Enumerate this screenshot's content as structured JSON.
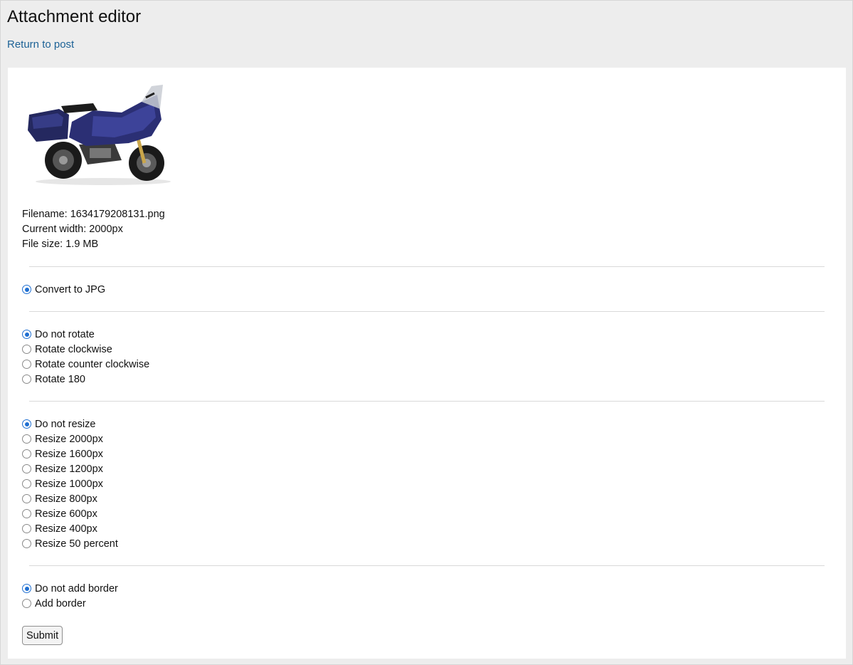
{
  "header": {
    "title": "Attachment editor",
    "return_link": "Return to post"
  },
  "file_info": {
    "filename": "Filename: 1634179208131.png",
    "width": "Current width: 2000px",
    "size": "File size: 1.9 MB"
  },
  "convert": {
    "options": [
      {
        "label": "Convert to JPG",
        "checked": true
      }
    ]
  },
  "rotate": {
    "options": [
      {
        "label": "Do not rotate",
        "checked": true
      },
      {
        "label": "Rotate clockwise",
        "checked": false
      },
      {
        "label": "Rotate counter clockwise",
        "checked": false
      },
      {
        "label": "Rotate 180",
        "checked": false
      }
    ]
  },
  "resize": {
    "options": [
      {
        "label": "Do not resize",
        "checked": true
      },
      {
        "label": "Resize 2000px",
        "checked": false
      },
      {
        "label": "Resize 1600px",
        "checked": false
      },
      {
        "label": "Resize 1200px",
        "checked": false
      },
      {
        "label": "Resize 1000px",
        "checked": false
      },
      {
        "label": "Resize 800px",
        "checked": false
      },
      {
        "label": "Resize 600px",
        "checked": false
      },
      {
        "label": "Resize 400px",
        "checked": false
      },
      {
        "label": "Resize 50 percent",
        "checked": false
      }
    ]
  },
  "border": {
    "options": [
      {
        "label": "Do not add border",
        "checked": true
      },
      {
        "label": "Add border",
        "checked": false
      }
    ]
  },
  "form": {
    "submit_label": "Submit"
  },
  "colors": {
    "link": "#1d6296",
    "radio_accent": "#1f6fd1",
    "page_bg": "#ededed"
  }
}
